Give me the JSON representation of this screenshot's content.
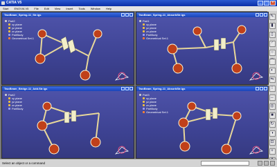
{
  "app": {
    "title": "CATIA V5",
    "menu": [
      "Start",
      "ENOVIA V5",
      "File",
      "Edit",
      "View",
      "Insert",
      "Tools",
      "Window",
      "Help"
    ]
  },
  "windows": [
    {
      "title": "TwoBeam_Spring-11_Str.igs",
      "tree": [
        "Part2",
        "xy plane",
        "yz plane",
        "zx plane",
        "PartBody",
        "Geometrical Set.1"
      ]
    },
    {
      "title": "TwoBeam_Spring-11_AbsorbStr.igs",
      "tree": [
        "Part1",
        "xy plane",
        "yz plane",
        "zx plane",
        "PartBody",
        "Geometrical Set.1"
      ]
    },
    {
      "title": "TwoBeam_Bridge-11_Add.Str.igs",
      "tree": [
        "Part2",
        "xy plane",
        "yz plane",
        "zx plane",
        "PartBody"
      ]
    },
    {
      "title": "TwoBeam_Spring-11_AbsorbStr.igs",
      "tree": [
        "Part3",
        "xy plane",
        "yz plane",
        "zx plane",
        "PartBody",
        "Geometrical Set.1"
      ]
    }
  ],
  "status": {
    "text": "Select an object or a command"
  },
  "colors": {
    "title_bar": "#0a2fa8",
    "viewport_bg": "#4a4fa0",
    "link_color": "#e8d89a",
    "joint_color": "#c0401a",
    "beam_color": "#f2eec8"
  }
}
